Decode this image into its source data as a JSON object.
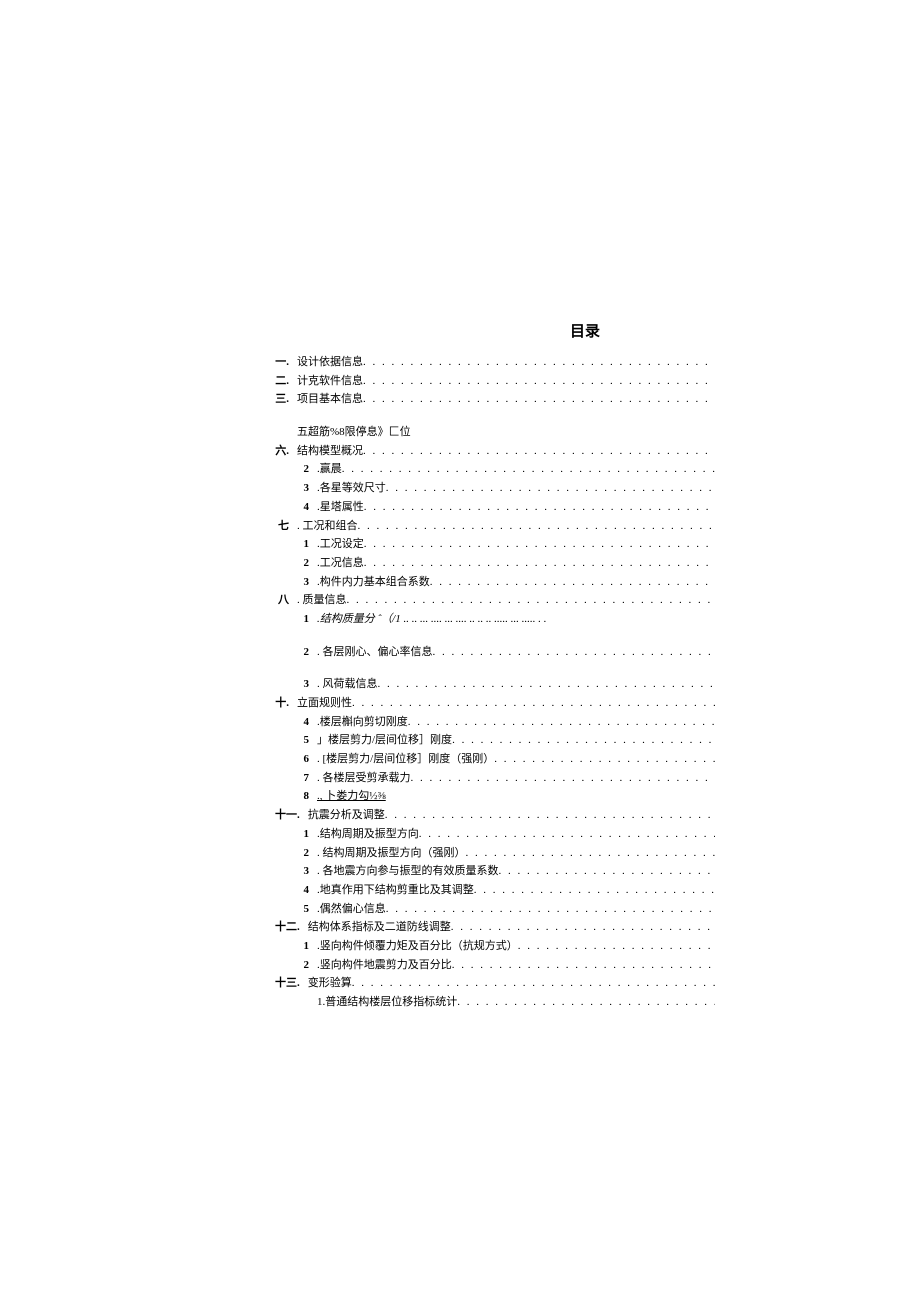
{
  "title": "目录",
  "items": [
    {
      "num": "一.",
      "label": "设计依据信息",
      "indent": 0,
      "dots": true
    },
    {
      "num": "二.",
      "label": "计克软件信息",
      "indent": 0,
      "dots": true
    },
    {
      "num": "三.",
      "label": "项目基本信息",
      "indent": 0,
      "dots": true
    },
    {
      "spacer": true
    },
    {
      "num": "",
      "label": "五超筋%8限停息》匚位",
      "indent": 0,
      "dots": false
    },
    {
      "num": "六.",
      "label": "结构模型概况",
      "indent": 0,
      "dots": true
    },
    {
      "num": "2",
      "label": ".赢晨",
      "indent": 1,
      "dots": true,
      "bold": true
    },
    {
      "num": "3",
      "label": ".各星等效尺寸",
      "indent": 1,
      "dots": true,
      "bold": true
    },
    {
      "num": "4",
      "label": ".星塔属性",
      "indent": 1,
      "dots": true,
      "bold": true
    },
    {
      "num": "七",
      "label": ". 工况和组合",
      "indent": 0,
      "dots": true
    },
    {
      "num": "1",
      "label": ".工况设定",
      "indent": 1,
      "dots": true,
      "bold": true
    },
    {
      "num": "2",
      "label": ".工况信息",
      "indent": 1,
      "dots": true,
      "bold": true
    },
    {
      "num": "3",
      "label": ".构件内力基本组合系数",
      "indent": 1,
      "dots": true,
      "bold": true
    },
    {
      "num": "八",
      "label": ". 质量信息",
      "indent": 0,
      "dots": true
    },
    {
      "num": "1",
      "label": ".结构质量分 ˆ（/1 .. .. ... .... ... .... .. .. .. .....  ... ..... . .",
      "indent": 1,
      "dots": false,
      "bold": true,
      "italic": true
    },
    {
      "spacer": true
    },
    {
      "num": "2",
      "label": ". 各层刚心、偏心率信息",
      "indent": 1,
      "dots": true,
      "bold": true
    },
    {
      "spacer": true
    },
    {
      "num": "3",
      "label": ". 风荷载信息",
      "indent": 1,
      "dots": true,
      "bold": true
    },
    {
      "num": "十.",
      "label": "立面规则性",
      "indent": 0,
      "dots": true
    },
    {
      "num": "4",
      "label": ".楼层槲向剪切刚度",
      "indent": 1,
      "dots": true,
      "bold": true
    },
    {
      "num": "5",
      "label": "」楼层剪力/层间位移］刚度",
      "indent": 1,
      "dots": true,
      "bold": true
    },
    {
      "num": "6",
      "label": ". [楼层剪力/层间位移］刚度（强刚）",
      "indent": 1,
      "dots": true,
      "bold": true
    },
    {
      "num": "7",
      "label": ". 各楼层受剪承载力",
      "indent": 1,
      "dots": true,
      "bold": true
    },
    {
      "num": "8",
      "label": ".,  卜娄力勾½⅜",
      "indent": 1,
      "dots": false,
      "bold": true,
      "underline": true
    },
    {
      "num": "十一.",
      "label": "抗震分析及调整",
      "indent": 0,
      "dots": true
    },
    {
      "num": "1",
      "label": ".结构周期及振型方向",
      "indent": 1,
      "dots": true,
      "bold": true
    },
    {
      "num": "2",
      "label": ". 结构周期及振型方向（强刚）",
      "indent": 1,
      "dots": true,
      "bold": true
    },
    {
      "num": "3",
      "label": ". 各地震方向参与振型的有效质量系数",
      "indent": 1,
      "dots": true,
      "bold": true
    },
    {
      "num": "4",
      "label": ".地真作用下结构剪重比及其调整",
      "indent": 1,
      "dots": true,
      "bold": true
    },
    {
      "num": "5",
      "label": ".偶然偏心信息",
      "indent": 1,
      "dots": true,
      "bold": true
    },
    {
      "num": "十二.",
      "label": "结构体系指标及二道防线调整",
      "indent": 0,
      "dots": true
    },
    {
      "num": "1",
      "label": ".竖向构件倾覆力矩及百分比（抗规方式）",
      "indent": 1,
      "dots": true,
      "bold": true
    },
    {
      "num": "2",
      "label": ".竖向构件地震剪力及百分比",
      "indent": 1,
      "dots": true,
      "bold": true
    },
    {
      "num": "十三.",
      "label": "变形验算",
      "indent": 0,
      "dots": true
    },
    {
      "num": "",
      "label": "1.普通结构楼层位移指标统计",
      "indent": 1,
      "dots": true,
      "bold": true
    }
  ]
}
